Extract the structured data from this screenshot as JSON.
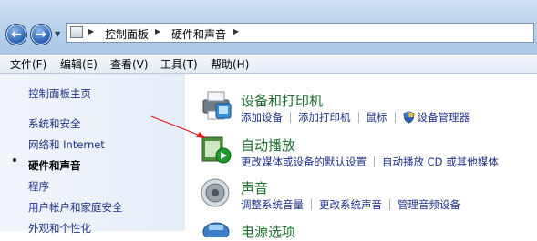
{
  "address": {
    "crumbs": [
      "控制面板",
      "硬件和声音"
    ]
  },
  "menu": [
    "文件(F)",
    "编辑(E)",
    "查看(V)",
    "工具(T)",
    "帮助(H)"
  ],
  "sidebar": {
    "items": [
      {
        "label": "控制面板主页"
      },
      {
        "label": "系统和安全"
      },
      {
        "label": "网络和 Internet"
      },
      {
        "label": "硬件和声音",
        "current": true
      },
      {
        "label": "程序"
      },
      {
        "label": "用户帐户和家庭安全"
      },
      {
        "label": "外观和个性化"
      }
    ]
  },
  "categories": [
    {
      "title": "设备和打印机",
      "icon": "printer-icon",
      "links": [
        "添加设备",
        "添加打印机",
        "鼠标",
        "设备管理器"
      ]
    },
    {
      "title": "自动播放",
      "icon": "autoplay-icon",
      "links": [
        "更改媒体或设备的默认设置",
        "自动播放 CD 或其他媒体"
      ]
    },
    {
      "title": "声音",
      "icon": "speaker-icon",
      "links": [
        "调整系统音量",
        "更改系统声音",
        "管理音频设备"
      ]
    },
    {
      "title": "电源选项",
      "icon": "power-icon",
      "links": []
    }
  ],
  "colors": {
    "category_title": "#1a6e2e",
    "link": "#1e3287",
    "annotation_arrow": "#e0191b"
  }
}
